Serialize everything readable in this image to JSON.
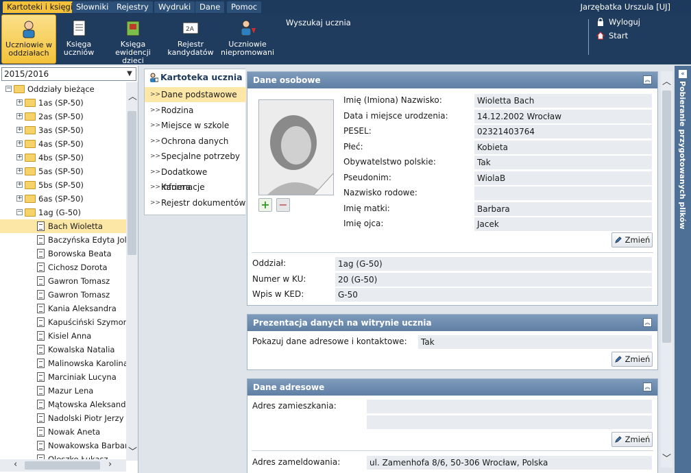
{
  "menu": {
    "items": [
      "Kartoteki i księgi",
      "Słowniki",
      "Rejestry",
      "Wydruki",
      "Dane",
      "Pomoc"
    ],
    "user": "Jarzębatka Urszula [UJ]"
  },
  "ribbon": {
    "buttons": [
      {
        "line1": "Uczniowie w",
        "line2": "oddziałach"
      },
      {
        "line1": "Księga",
        "line2": "uczniów"
      },
      {
        "line1": "Księga",
        "line2": "ewidencji dzieci"
      },
      {
        "line1": "Rejestr",
        "line2": "kandydatów"
      },
      {
        "line1": "Uczniowie",
        "line2": "niepromowani"
      }
    ],
    "search": "Wyszukaj ucznia",
    "logout": "Wyloguj",
    "start": "Start"
  },
  "tree": {
    "year": "2015/2016",
    "root": "Oddziały bieżące",
    "classes": [
      "1as (SP-50)",
      "2as (SP-50)",
      "3as (SP-50)",
      "4as (SP-50)",
      "4bs (SP-50)",
      "5as (SP-50)",
      "5bs (SP-50)",
      "6as (SP-50)",
      "1ag (G-50)"
    ],
    "students": [
      "Bach Wioletta",
      "Baczyńska Edyta Jolanta",
      "Borowska Beata",
      "Cichosz Dorota",
      "Gawron Tomasz",
      "Gawron Tomasz",
      "Kania Aleksandra",
      "Kapuściński Szymon",
      "Kisiel Anna",
      "Kowalska Natalia",
      "Malinowska Karolina",
      "Marciniak Lucyna",
      "Mazur Lena",
      "Mątowska Aleksandra",
      "Nadolski Piotr Jerzy",
      "Nowak Aneta",
      "Nowakowska Barbara",
      "Oleszko Łukasz"
    ]
  },
  "nav": {
    "title": "Kartoteka ucznia",
    "items": [
      "Dane podstawowe",
      "Rodzina",
      "Miejsce w szkole",
      "Ochrona danych",
      "Specjalne potrzeby",
      "Dodatkowe informacje",
      "Kariera",
      "Rejestr dokumentów"
    ]
  },
  "personal": {
    "title": "Dane osobowe",
    "fields": [
      {
        "label": "Imię (Imiona) Nazwisko:",
        "value": "Wioletta Bach"
      },
      {
        "label": "Data i miejsce urodzenia:",
        "value": "14.12.2002 Wrocław"
      },
      {
        "label": "PESEL:",
        "value": "02321403764"
      },
      {
        "label": "Płeć:",
        "value": "Kobieta"
      },
      {
        "label": "Obywatelstwo polskie:",
        "value": "Tak"
      },
      {
        "label": "Pseudonim:",
        "value": "WiolaB"
      },
      {
        "label": "Nazwisko rodowe:",
        "value": ""
      },
      {
        "label": "Imię matki:",
        "value": "Barbara"
      },
      {
        "label": "Imię ojca:",
        "value": "Jacek"
      }
    ],
    "school": [
      {
        "label": "Oddział:",
        "value": "1ag (G-50)"
      },
      {
        "label": "Numer w KU:",
        "value": "20 (G-50)"
      },
      {
        "label": "Wpis w KED:",
        "value": "G-50"
      }
    ],
    "change": "Zmień"
  },
  "presentation": {
    "title": "Prezentacja danych na witrynie ucznia",
    "label": "Pokazuj dane adresowe i kontaktowe:",
    "value": "Tak",
    "change": "Zmień"
  },
  "address": {
    "title": "Dane adresowe",
    "residence_label": "Adres zamieszkania:",
    "residence_line1": "",
    "residence_line2": "",
    "change": "Zmień",
    "registered_label": "Adres zameldowania:",
    "registered_value": "ul. Zamenhofa 8/6, 50-306 Wrocław, Polska"
  },
  "side_tab": "Pobieranie przygotowanych plików",
  "colors": {
    "accent": "#f3c23a",
    "header": "#1d3a5c",
    "selected_row": "#fde7a6"
  }
}
